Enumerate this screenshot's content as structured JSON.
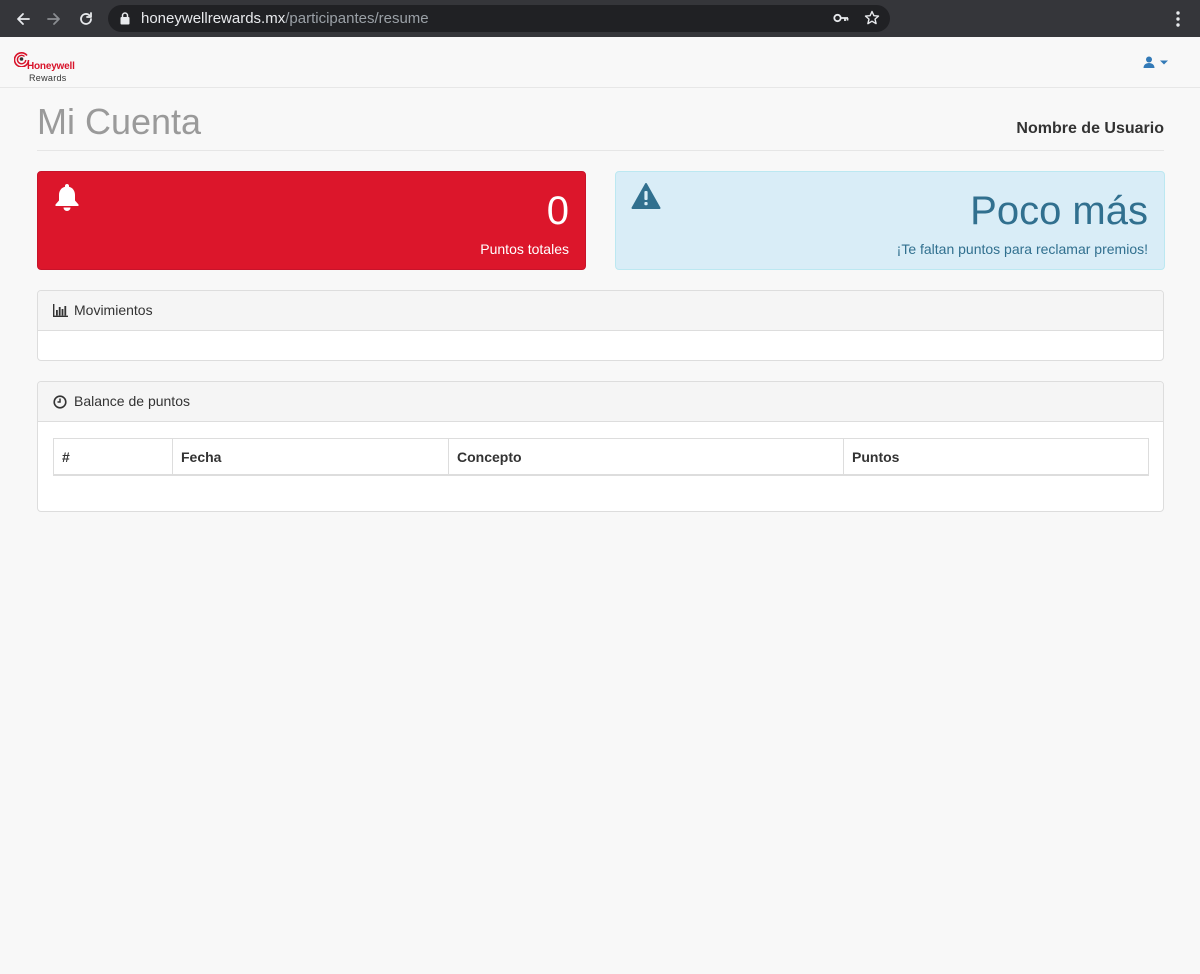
{
  "browser": {
    "url_host": "honeywellrewards.mx",
    "url_path": "/participantes/resume",
    "icons": [
      "back-icon",
      "forward-icon",
      "reload-icon",
      "lock-icon",
      "key-icon",
      "star-icon",
      "menu-icon"
    ]
  },
  "navbar": {
    "logo_brand": "Honeywell",
    "logo_sub": "Rewards",
    "user_icon": "user-icon"
  },
  "header": {
    "title": "Mi Cuenta",
    "username": "Nombre de Usuario"
  },
  "stats": {
    "points": {
      "value": "0",
      "label": "Puntos totales",
      "icon": "bell-icon",
      "color": "#dc162b"
    },
    "status": {
      "value": "Poco más",
      "label": "¡Te faltan puntos para reclamar premios!",
      "icon": "warning-icon",
      "color": "#31708f"
    }
  },
  "panels": {
    "movimientos": {
      "title": "Movimientos",
      "icon": "bar-chart-icon"
    },
    "balance": {
      "title": "Balance de puntos",
      "icon": "clock-icon",
      "columns": [
        "#",
        "Fecha",
        "Concepto",
        "Puntos"
      ]
    }
  }
}
